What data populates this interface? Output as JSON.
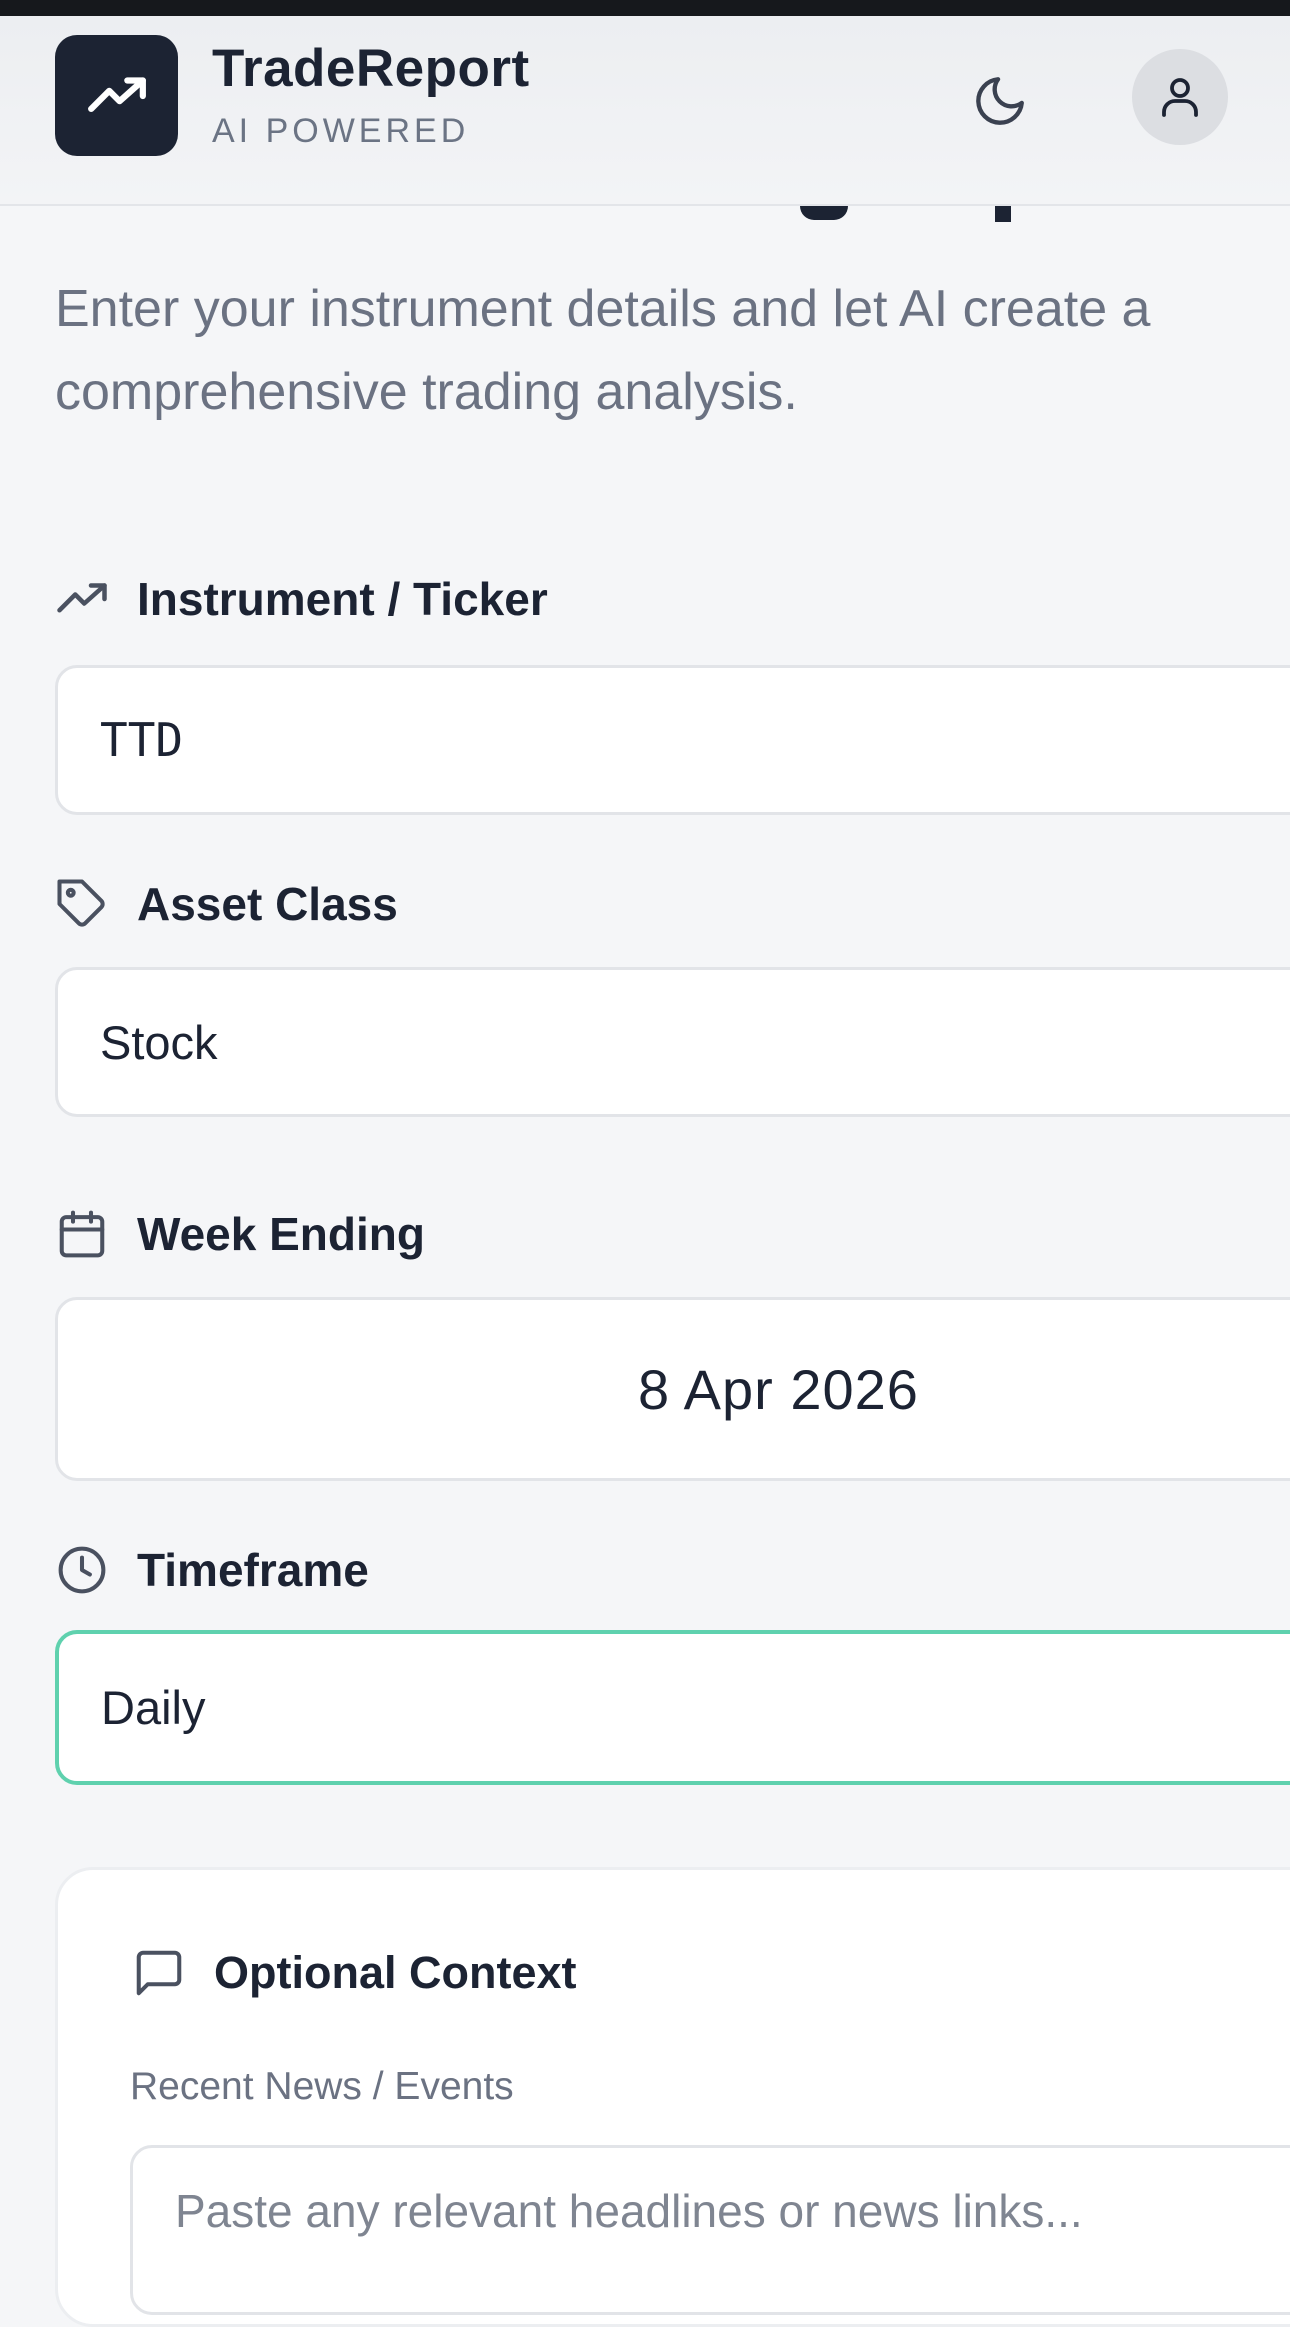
{
  "header": {
    "brand_name": "TradeReport",
    "brand_tagline": "AI POWERED",
    "logo_icon": "trending-up-icon",
    "theme_icon": "moon-icon",
    "account_icon": "user-icon"
  },
  "intro": {
    "line1": "Enter your instrument details and let AI create a",
    "line2": "comprehensive trading analysis."
  },
  "form": {
    "instrument": {
      "label": "Instrument / Ticker",
      "value": "TTD",
      "icon": "trending-up-icon"
    },
    "asset_class": {
      "label": "Asset Class",
      "value": "Stock",
      "icon": "tag-icon"
    },
    "week_ending": {
      "label": "Week Ending",
      "value": "8 Apr 2026",
      "icon": "calendar-icon"
    },
    "timeframe": {
      "label": "Timeframe",
      "value": "Daily",
      "icon": "clock-icon"
    }
  },
  "context": {
    "title": "Optional Context",
    "icon": "message-square-icon",
    "news_label": "Recent News / Events",
    "news_placeholder": "Paste any relevant headlines or news links..."
  },
  "colors": {
    "accent": "#5fd1ae",
    "brand_dark": "#1c2333",
    "background": "#f5f6f8"
  }
}
